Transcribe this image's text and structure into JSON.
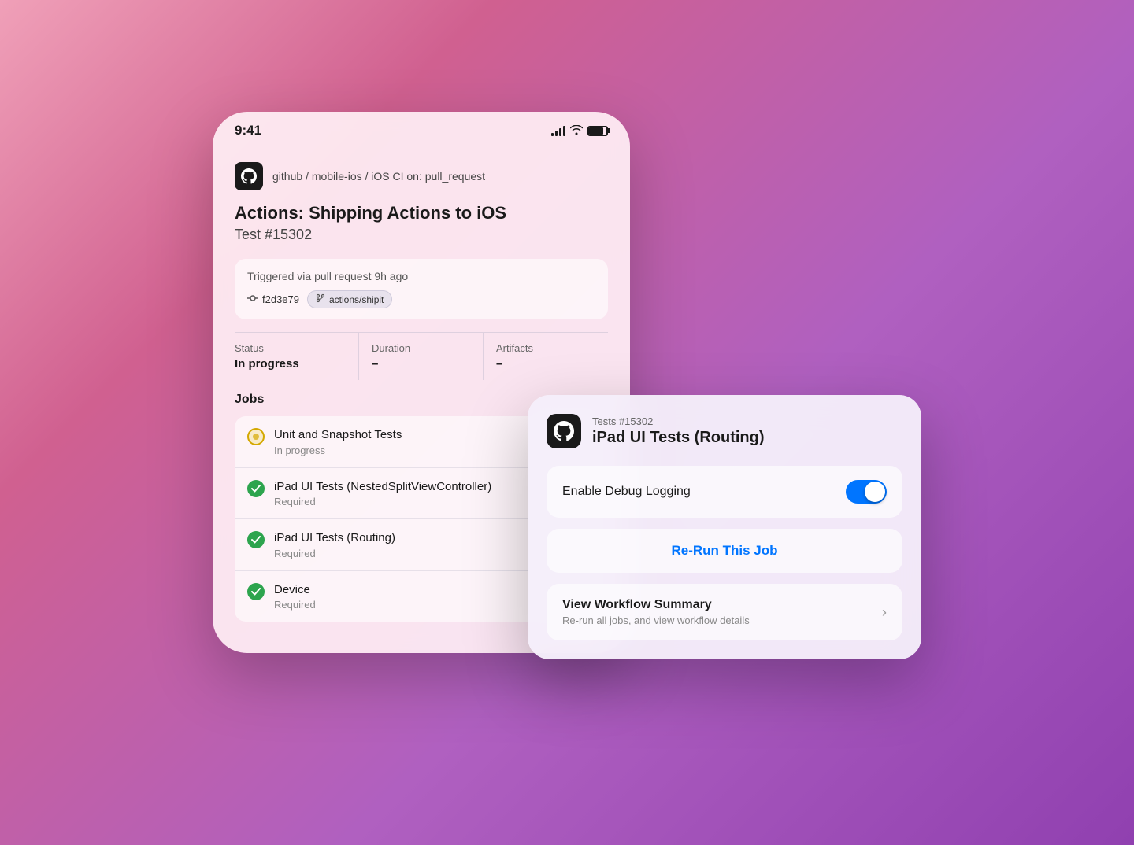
{
  "background": {
    "gradient": "linear-gradient(135deg, #f0a0b8 0%, #d06090 25%, #b060c0 60%, #9040b0 100%)"
  },
  "iphone": {
    "statusBar": {
      "time": "9:41",
      "signal": "signal",
      "wifi": "wifi",
      "battery": "battery"
    },
    "appHeader": {
      "repo": "github / mobile-ios / iOS CI on: pull_request"
    },
    "pageTitle": "Actions: Shipping Actions to iOS",
    "pageSubtitle": "Test #15302",
    "triggerCard": {
      "text": "Triggered via pull request 9h ago",
      "commit": "f2d3e79",
      "branch": "actions/shipit"
    },
    "statusTable": {
      "columns": [
        {
          "label": "Status",
          "value": "In progress"
        },
        {
          "label": "Duration",
          "value": "–"
        },
        {
          "label": "Artifacts",
          "value": "–"
        }
      ]
    },
    "jobs": {
      "heading": "Jobs",
      "items": [
        {
          "type": "progress",
          "name": "Unit and Snapshot Tests",
          "sub": "In progress"
        },
        {
          "type": "check",
          "name": "iPad UI Tests (NestedSplitViewController)",
          "sub": "Required"
        },
        {
          "type": "check",
          "name": "iPad UI Tests (Routing)",
          "sub": "Required"
        },
        {
          "type": "check",
          "name": "Device",
          "sub": "Required"
        }
      ]
    }
  },
  "popup": {
    "testNum": "Tests #15302",
    "title": "iPad UI Tests (Routing)",
    "toggleLabel": "Enable Debug Logging",
    "toggleOn": true,
    "rerunLabel": "Re-Run This Job",
    "workflow": {
      "title": "View Workflow Summary",
      "subtitle": "Re-run all jobs, and view workflow details"
    }
  }
}
